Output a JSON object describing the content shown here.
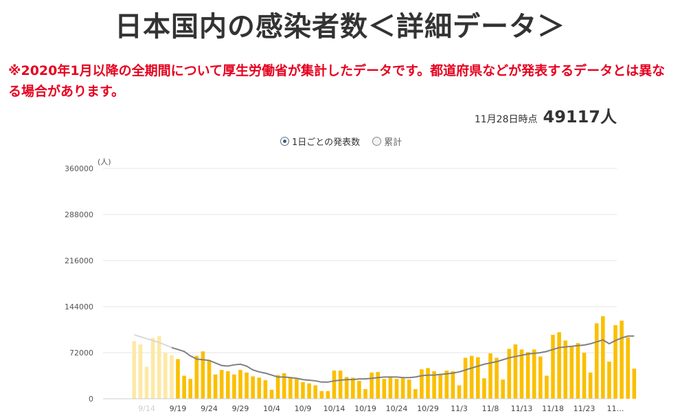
{
  "header": {
    "title": "日本国内の感染者数＜詳細データ＞",
    "notice": "※2020年1月以降の全期間について厚生労働省が集計したデータです。都道府県などが発表するデータとは異なる場合があります。"
  },
  "summary": {
    "as_of_label": "11月28日時点",
    "total_count": "49117人"
  },
  "toggle": {
    "daily_label": "1日ごとの発表数",
    "cumulative_label": "累計",
    "selected": "daily"
  },
  "colors": {
    "bar": "#fbbf00",
    "bar_faded": "#fde9a6",
    "line": "#808080",
    "grid": "#e6e6e6",
    "notice": "#e6001f"
  },
  "chart_data": {
    "type": "bar",
    "y_unit_label": "(人)",
    "ylim": [
      0,
      360000
    ],
    "yticks": [
      "0",
      "72000",
      "144000",
      "216000",
      "288000",
      "360000"
    ],
    "x_tick_labels": [
      "9/14",
      "9/19",
      "9/24",
      "9/29",
      "10/4",
      "10/9",
      "10/14",
      "10/19",
      "10/24",
      "10/29",
      "11/3",
      "11/8",
      "11/13",
      "11/18",
      "11/23",
      "11…"
    ],
    "grid": true,
    "categories": [
      "9/12",
      "9/13",
      "9/14",
      "9/15",
      "9/16",
      "9/17",
      "9/18",
      "9/19",
      "9/20",
      "9/21",
      "9/22",
      "9/23",
      "9/24",
      "9/25",
      "9/26",
      "9/27",
      "9/28",
      "9/29",
      "9/30",
      "10/1",
      "10/2",
      "10/3",
      "10/4",
      "10/5",
      "10/6",
      "10/7",
      "10/8",
      "10/9",
      "10/10",
      "10/11",
      "10/12",
      "10/13",
      "10/14",
      "10/15",
      "10/16",
      "10/17",
      "10/18",
      "10/19",
      "10/20",
      "10/21",
      "10/22",
      "10/23",
      "10/24",
      "10/25",
      "10/26",
      "10/27",
      "10/28",
      "10/29",
      "10/30",
      "10/31",
      "11/1",
      "11/2",
      "11/3",
      "11/4",
      "11/5",
      "11/6",
      "11/7",
      "11/8",
      "11/9",
      "11/10",
      "11/11",
      "11/12",
      "11/13",
      "11/14",
      "11/15",
      "11/16",
      "11/17",
      "11/18",
      "11/19",
      "11/20",
      "11/21",
      "11/22",
      "11/23",
      "11/24",
      "11/25",
      "11/26",
      "11/27",
      "11/28"
    ],
    "series": [
      {
        "values": [
          90000,
          85000,
          50000,
          95000,
          98000,
          72000,
          68000,
          62000,
          36000,
          31000,
          67000,
          74000,
          60000,
          38000,
          45000,
          43000,
          38000,
          45000,
          41000,
          35000,
          33000,
          29000,
          14000,
          37000,
          40000,
          34000,
          31000,
          26000,
          24000,
          21000,
          12000,
          12000,
          44000,
          44000,
          34000,
          33000,
          28000,
          15000,
          41000,
          42000,
          31000,
          35000,
          31000,
          32000,
          30000,
          15000,
          46000,
          48000,
          43000,
          39000,
          44000,
          43000,
          21000,
          64000,
          67000,
          65000,
          32000,
          71000,
          64000,
          30000,
          78000,
          85000,
          77000,
          73000,
          77000,
          66000,
          36000,
          100000,
          104000,
          91000,
          82000,
          87000,
          72000,
          41000,
          118000,
          129000,
          58000,
          115000,
          122000,
          96000,
          47000
        ]
      },
      {
        "values": [
          100000,
          97000,
          94000,
          91000,
          88000,
          84000,
          80000,
          77000,
          74000,
          67000,
          62000,
          61000,
          60000,
          56000,
          52000,
          51000,
          53000,
          54000,
          51000,
          45000,
          42000,
          40000,
          37000,
          34000,
          34000,
          33000,
          32000,
          30000,
          29000,
          28000,
          26000,
          26000,
          28000,
          29000,
          30000,
          30000,
          31000,
          31000,
          32000,
          33000,
          34000,
          34000,
          34000,
          33000,
          33000,
          34000,
          36000,
          37000,
          37000,
          38000,
          39000,
          40000,
          42000,
          45000,
          48000,
          51000,
          54000,
          56000,
          58000,
          61000,
          64000,
          66000,
          68000,
          70000,
          71000,
          72000,
          74000,
          77000,
          80000,
          81000,
          82000,
          83000,
          84000,
          86000,
          89000,
          92000,
          86000,
          91000,
          95000,
          98000,
          98000
        ]
      }
    ]
  }
}
